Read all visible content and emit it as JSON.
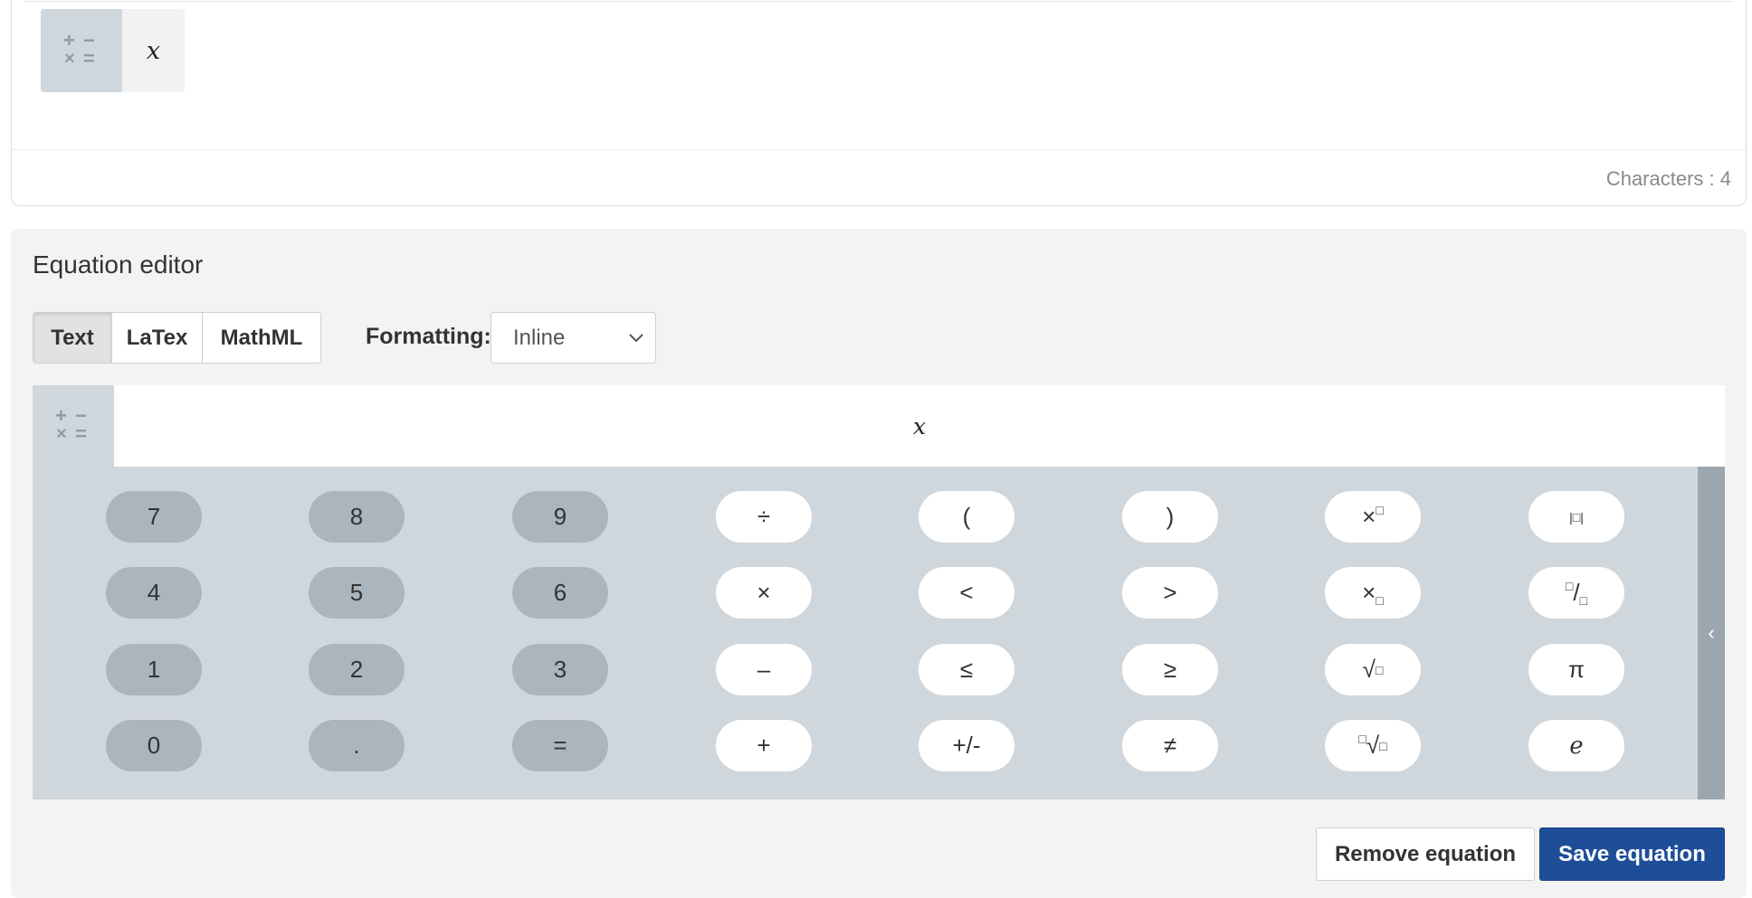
{
  "answer": {
    "equation_value": "x",
    "char_count": "Characters : 4",
    "ops_icon": "math-operators-icon"
  },
  "editor": {
    "title": "Equation editor",
    "modes": [
      "Text",
      "LaTex",
      "MathML"
    ],
    "active_mode": "Text",
    "formatting_label": "Formatting:",
    "formatting_value": "Inline",
    "input_value": "x",
    "keys": {
      "row1": [
        "7",
        "8",
        "9",
        "÷",
        "(",
        ")",
        "×□",
        "|□|"
      ],
      "row2": [
        "4",
        "5",
        "6",
        "×",
        "<",
        ">",
        "×□",
        "□/□"
      ],
      "row3": [
        "1",
        "2",
        "3",
        "–",
        "≤",
        "≥",
        "√□",
        "π"
      ],
      "row4": [
        "0",
        ".",
        "=",
        "+",
        "+/-",
        "≠",
        "□√□",
        "e"
      ]
    },
    "collapse_glyph": "‹",
    "remove_label": "Remove equation",
    "save_label": "Save equation"
  },
  "colors": {
    "primary": "#1f4e99",
    "keypad_bg": "#d0d7dc",
    "num_key": "#aab5bd",
    "panel_bg": "#f3f3f3"
  }
}
